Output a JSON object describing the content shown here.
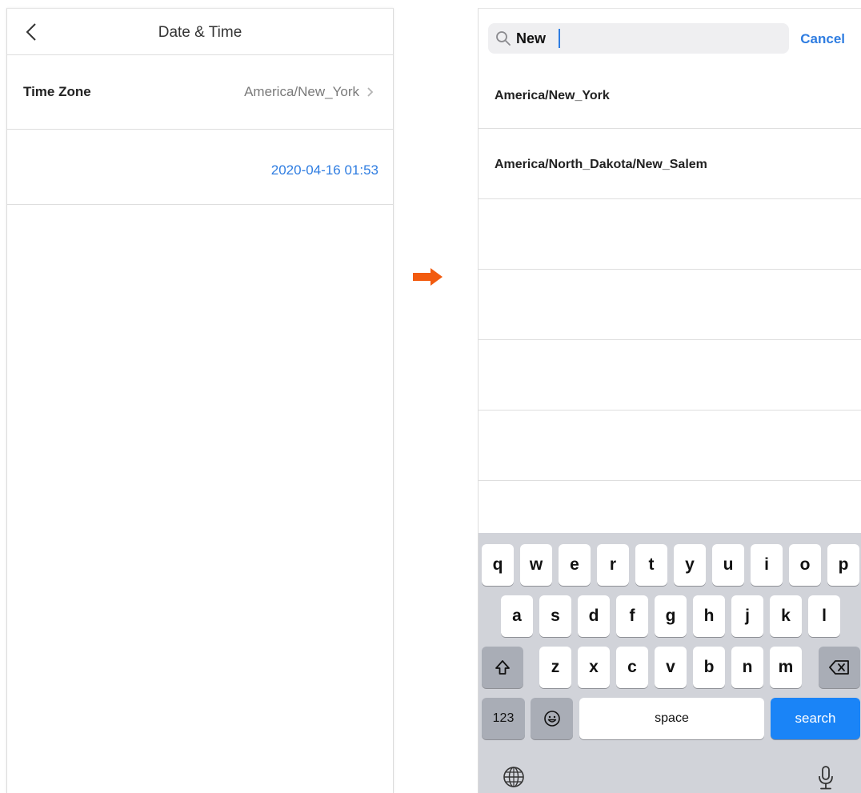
{
  "left_screen": {
    "nav": {
      "title": "Date & Time"
    },
    "time_zone": {
      "label": "Time Zone",
      "value": "America/New_York"
    },
    "datetime": {
      "value": "2020-04-16 01:53"
    }
  },
  "right_screen": {
    "search": {
      "query": "New",
      "cancel_label": "Cancel"
    },
    "results": [
      "America/New_York",
      "America/North_Dakota/New_Salem"
    ],
    "keyboard": {
      "row1": [
        "q",
        "w",
        "e",
        "r",
        "t",
        "y",
        "u",
        "i",
        "o",
        "p"
      ],
      "row2": [
        "a",
        "s",
        "d",
        "f",
        "g",
        "h",
        "j",
        "k",
        "l"
      ],
      "row3": [
        "z",
        "x",
        "c",
        "v",
        "b",
        "n",
        "m"
      ],
      "numbers_label": "123",
      "space_label": "space",
      "search_label": "search"
    }
  },
  "colors": {
    "accent": "#2f7de1",
    "transition_arrow": "#f25b0f",
    "search_key": "#1a84f7"
  }
}
